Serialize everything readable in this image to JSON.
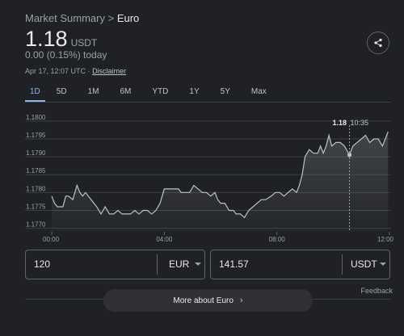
{
  "breadcrumb": {
    "parent": "Market Summary",
    "separator": ">",
    "current": "Euro"
  },
  "quote": {
    "price": "1.18",
    "unit": "USDT",
    "change": "0.00 (0.15%) today"
  },
  "meta": {
    "timestamp": "Apr 17, 12:07 UTC ·",
    "disclaimer": "Disclaimer"
  },
  "tabs": [
    {
      "label": "1D",
      "active": true
    },
    {
      "label": "5D"
    },
    {
      "label": "1M"
    },
    {
      "label": "6M"
    },
    {
      "label": "YTD"
    },
    {
      "label": "1Y"
    },
    {
      "label": "5Y"
    },
    {
      "label": "Max"
    }
  ],
  "chart_data": {
    "type": "area",
    "x_ticks": [
      "00:00",
      "04:00",
      "08:00",
      "12:00"
    ],
    "y_ticks": [
      "1.1800",
      "1.1795",
      "1.1790",
      "1.1785",
      "1.1780",
      "1.1775",
      "1.1770"
    ],
    "ylim": [
      1.1769,
      1.1802
    ],
    "xlim": [
      0,
      12
    ],
    "tooltip": {
      "value": "1.18",
      "time": "10:35",
      "x": 10.58,
      "y": 1.17905
    },
    "series": [
      {
        "values": [
          [
            0.0,
            1.1779
          ],
          [
            0.1,
            1.1777
          ],
          [
            0.2,
            1.1776
          ],
          [
            0.4,
            1.1776
          ],
          [
            0.5,
            1.1779
          ],
          [
            0.6,
            1.1779
          ],
          [
            0.75,
            1.1778
          ],
          [
            0.9,
            1.1782
          ],
          [
            1.0,
            1.178
          ],
          [
            1.1,
            1.1779
          ],
          [
            1.2,
            1.178
          ],
          [
            1.4,
            1.1778
          ],
          [
            1.6,
            1.1776
          ],
          [
            1.75,
            1.1774
          ],
          [
            1.9,
            1.1776
          ],
          [
            2.05,
            1.1774
          ],
          [
            2.2,
            1.1774
          ],
          [
            2.35,
            1.1775
          ],
          [
            2.5,
            1.1774
          ],
          [
            2.65,
            1.1774
          ],
          [
            2.8,
            1.1774
          ],
          [
            2.95,
            1.1775
          ],
          [
            3.1,
            1.1774
          ],
          [
            3.25,
            1.1775
          ],
          [
            3.4,
            1.1775
          ],
          [
            3.55,
            1.1774
          ],
          [
            3.7,
            1.1775
          ],
          [
            3.85,
            1.1777
          ],
          [
            4.0,
            1.1781
          ],
          [
            4.1,
            1.1781
          ],
          [
            4.3,
            1.1781
          ],
          [
            4.5,
            1.1781
          ],
          [
            4.6,
            1.178
          ],
          [
            4.75,
            1.178
          ],
          [
            4.9,
            1.178
          ],
          [
            5.05,
            1.1782
          ],
          [
            5.2,
            1.1781
          ],
          [
            5.35,
            1.178
          ],
          [
            5.5,
            1.178
          ],
          [
            5.65,
            1.1779
          ],
          [
            5.8,
            1.178
          ],
          [
            5.9,
            1.1778
          ],
          [
            6.0,
            1.1777
          ],
          [
            6.15,
            1.1777
          ],
          [
            6.3,
            1.1775
          ],
          [
            6.45,
            1.1775
          ],
          [
            6.55,
            1.1774
          ],
          [
            6.7,
            1.1774
          ],
          [
            6.85,
            1.1773
          ],
          [
            7.0,
            1.1775
          ],
          [
            7.15,
            1.1776
          ],
          [
            7.3,
            1.1777
          ],
          [
            7.45,
            1.1778
          ],
          [
            7.6,
            1.1778
          ],
          [
            7.8,
            1.1779
          ],
          [
            7.95,
            1.178
          ],
          [
            8.1,
            1.178
          ],
          [
            8.25,
            1.1779
          ],
          [
            8.4,
            1.178
          ],
          [
            8.55,
            1.1781
          ],
          [
            8.7,
            1.178
          ],
          [
            8.8,
            1.1782
          ],
          [
            8.9,
            1.1785
          ],
          [
            9.0,
            1.179
          ],
          [
            9.15,
            1.1792
          ],
          [
            9.3,
            1.1791
          ],
          [
            9.45,
            1.1791
          ],
          [
            9.55,
            1.1793
          ],
          [
            9.65,
            1.1791
          ],
          [
            9.75,
            1.1793
          ],
          [
            9.85,
            1.1796
          ],
          [
            9.95,
            1.1793
          ],
          [
            10.1,
            1.1794
          ],
          [
            10.25,
            1.1794
          ],
          [
            10.4,
            1.1793
          ],
          [
            10.58,
            1.17905
          ],
          [
            10.7,
            1.1793
          ],
          [
            10.85,
            1.1794
          ],
          [
            11.0,
            1.1795
          ],
          [
            11.15,
            1.1796
          ],
          [
            11.3,
            1.1794
          ],
          [
            11.45,
            1.1795
          ],
          [
            11.6,
            1.1795
          ],
          [
            11.75,
            1.1793
          ],
          [
            11.85,
            1.1795
          ],
          [
            11.95,
            1.1797
          ]
        ]
      }
    ]
  },
  "converter": {
    "from_value": "120",
    "from_currency": "EUR",
    "to_value": "141.57",
    "to_currency": "USDT"
  },
  "feedback": "Feedback",
  "more_button": "More about Euro",
  "icons": {
    "share": "share-icon",
    "dropdown": "chevron-down-icon",
    "more": "chevron-right-icon"
  },
  "colors": {
    "accent": "#8ab4f8",
    "line": "#bdc1c6",
    "background": "#202124"
  }
}
